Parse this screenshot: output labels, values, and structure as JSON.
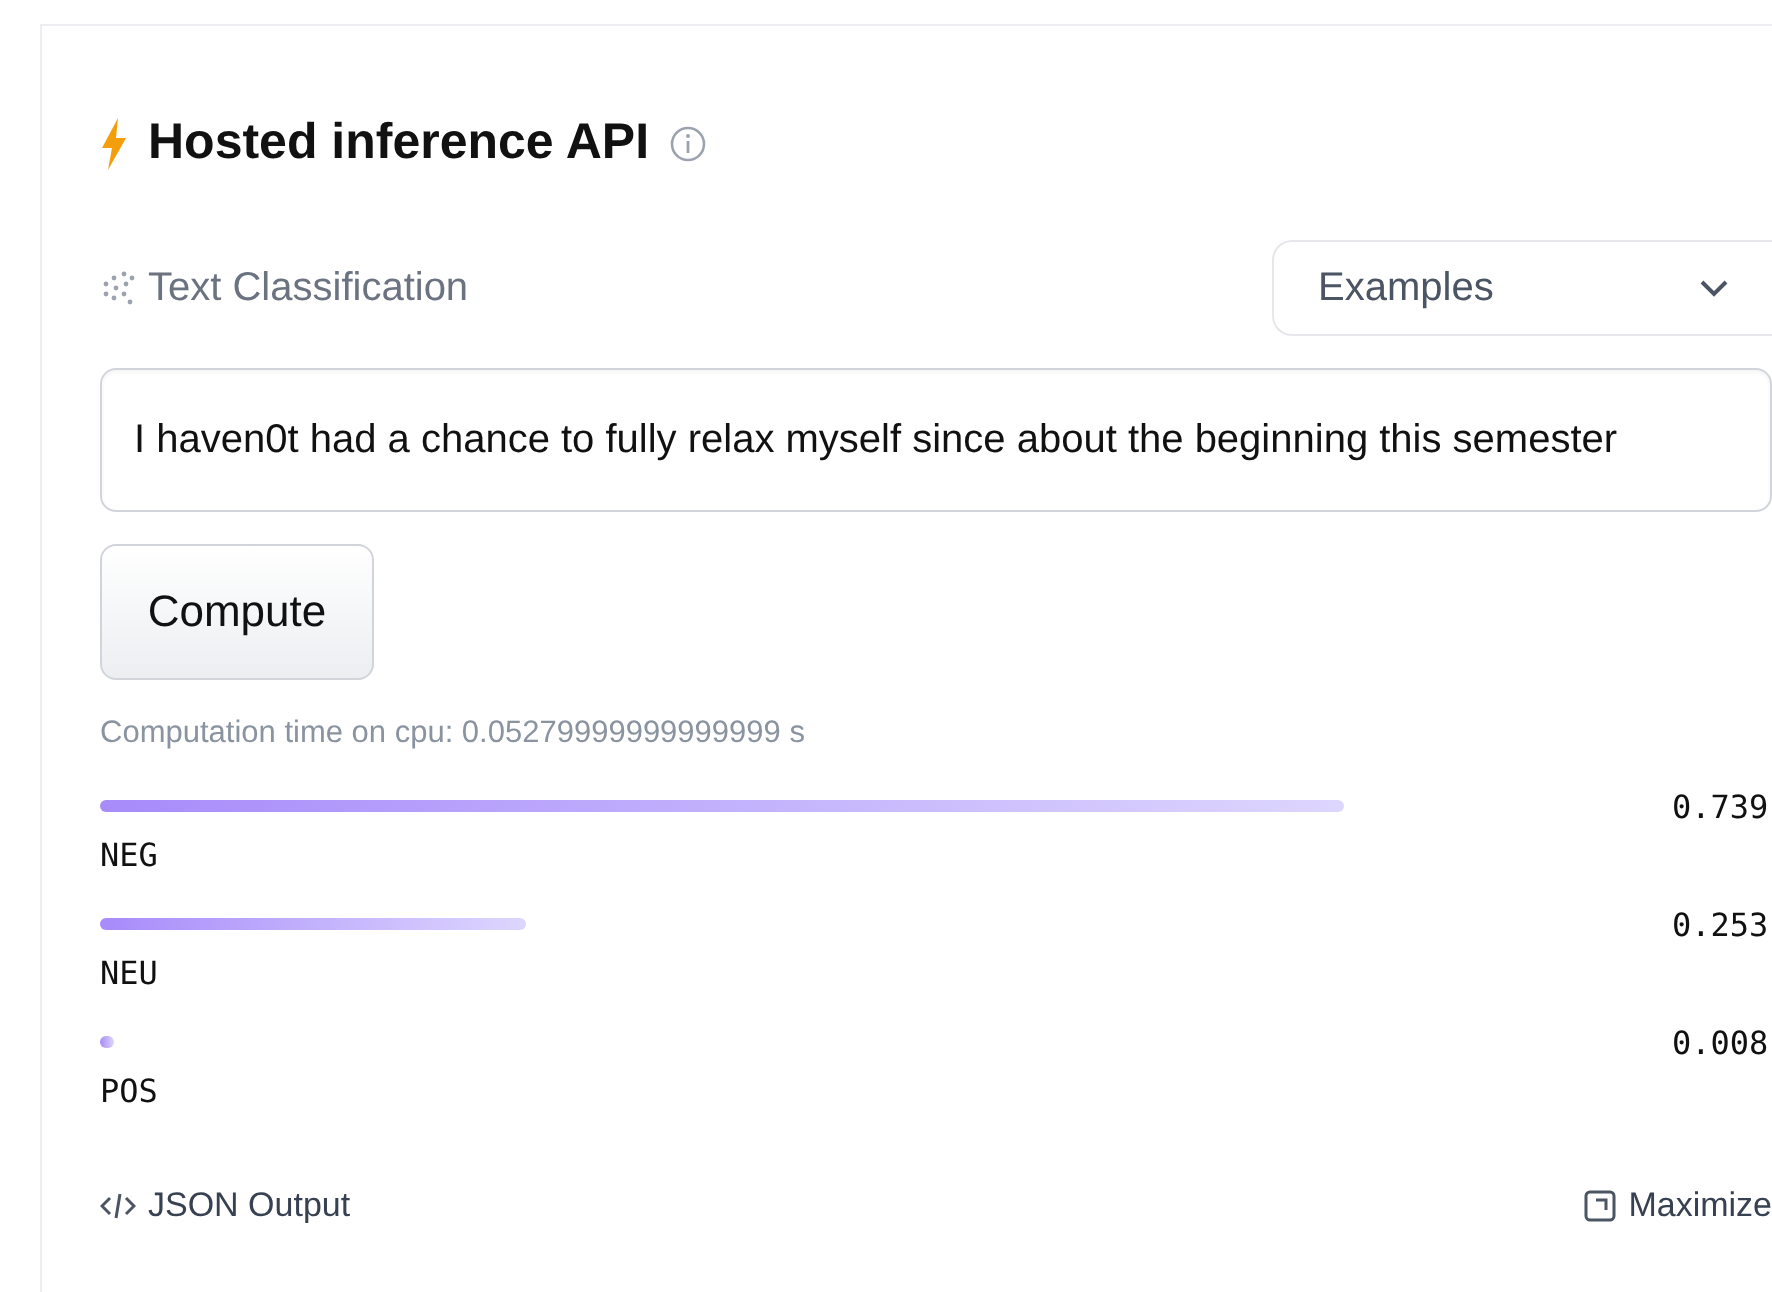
{
  "header": {
    "title": "Hosted inference API"
  },
  "task": {
    "label": "Text Classification"
  },
  "examples": {
    "label": "Examples"
  },
  "input": {
    "value": "I haven0t had a chance to fully relax myself since about the beginning this semester"
  },
  "compute": {
    "label": "Compute"
  },
  "timing": "Computation time on cpu: 0.05279999999999999 s",
  "results": [
    {
      "label": "NEG",
      "score": "0.739"
    },
    {
      "label": "NEU",
      "score": "0.253"
    },
    {
      "label": "POS",
      "score": "0.008"
    }
  ],
  "footer": {
    "json": "JSON Output",
    "maximize": "Maximize"
  }
}
